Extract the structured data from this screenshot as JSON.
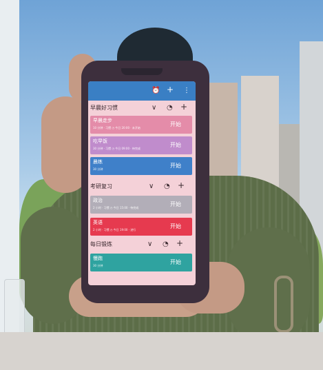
{
  "colors": {
    "toolbar": "#3a7fc4",
    "screen_bg": "#f4d1d8",
    "phone_case": "#3d2f3d"
  },
  "toolbar": {
    "icons": [
      "alarm-icon",
      "plus-icon",
      "more-vertical-icon"
    ],
    "alarm_glyph": "⏰",
    "add_glyph": "+",
    "more_glyph": "⋮"
  },
  "section_icons": {
    "collapse_glyph": "∨",
    "stats_glyph": "◔",
    "add_glyph": "+"
  },
  "sections": [
    {
      "title": "早晨好习惯",
      "tasks": [
        {
          "name": "早晨走步",
          "meta": "10 分钟 · 习惯  ◷  今日 20:00 · 未开始",
          "start": "开始",
          "color": "#e48ca9"
        },
        {
          "name": "吃早饭",
          "meta": "30 分钟 · 习惯  ◷  今日 09:00 · 待完成",
          "start": "开始",
          "color": "#c08ccc"
        },
        {
          "name": "晨练",
          "meta": "30 分钟",
          "start": "开始",
          "color": "#3f80c9"
        }
      ]
    },
    {
      "title": "考研复习",
      "tasks": [
        {
          "name": "政治",
          "meta": "2 小时 · 习惯  ◷  今日 15:00 · 待完成",
          "start": "开始",
          "color": "#b2aeb8"
        },
        {
          "name": "英语",
          "meta": "2 小时 · 习惯  ◷  今日 19:00 · 进行",
          "start": "开始",
          "color": "#e63a4f"
        }
      ]
    },
    {
      "title": "每日锻炼",
      "tasks": [
        {
          "name": "慢跑",
          "meta": "30 分钟",
          "start": "开始",
          "color": "#2fa3a0"
        }
      ]
    }
  ]
}
